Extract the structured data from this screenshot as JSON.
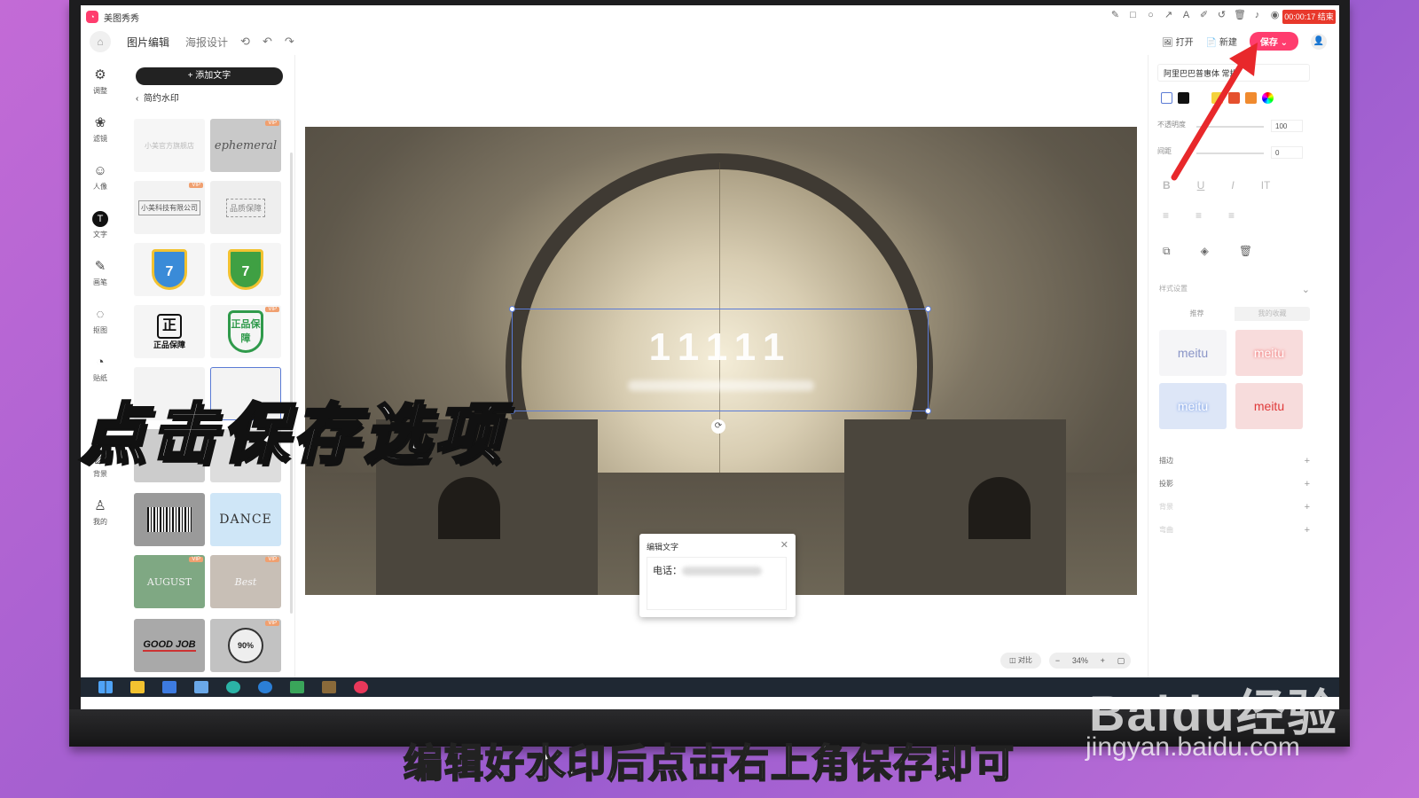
{
  "app": {
    "title": "美图秀秀",
    "record_time": "00:00:17 结束"
  },
  "menu": {
    "items": [
      "图片编辑",
      "海报设计"
    ],
    "open": "打开",
    "new": "新建",
    "save": "保存"
  },
  "rail": [
    {
      "label": "调整",
      "icon": "adjust-icon"
    },
    {
      "label": "滤镜",
      "icon": "filter-icon"
    },
    {
      "label": "人像",
      "icon": "portrait-icon"
    },
    {
      "label": "文字",
      "icon": "text-icon"
    },
    {
      "label": "画笔",
      "icon": "brush-icon"
    },
    {
      "label": "抠图",
      "icon": "cutout-icon"
    },
    {
      "label": "贴纸",
      "icon": "sticker-icon"
    },
    {
      "label": "背景",
      "icon": "background-icon"
    },
    {
      "label": "我的",
      "icon": "my-icon"
    }
  ],
  "panel": {
    "add_text": "+ 添加文字",
    "back_label": "简约水印",
    "thumbs": [
      "小美官方旗舰店",
      "ephemeral",
      "小美科技有限公司",
      "品质保障",
      "7",
      "7",
      "正品保障",
      "正品保障",
      "",
      "",
      "",
      "",
      "",
      "DANCE",
      "AUGUST",
      "Best",
      "GOOD JOB",
      "90% OFF"
    ]
  },
  "canvas": {
    "watermark_text": "11111"
  },
  "edit_dialog": {
    "title": "编辑文字",
    "content_label": "电话："
  },
  "right_panel": {
    "font": "阿里巴巴普惠体 常规",
    "opacity_label": "不透明度",
    "opacity_value": "100",
    "spacing_label": "间距",
    "spacing_value": "0",
    "style_section": "样式设置",
    "style_tabs": [
      "推荐",
      "我的收藏"
    ],
    "style_sample": "meitu",
    "items": [
      "描边",
      "投影",
      "背景",
      "弯曲"
    ]
  },
  "zoom": {
    "compare": "对比",
    "level": "34%"
  },
  "overlay": {
    "caption": "点击保存选项",
    "subtitle": "编辑好水印后点击右上角保存即可",
    "brand": "Baidu经验",
    "url": "jingyan.baidu.com"
  },
  "colors": {
    "accent": "#ff3d6e",
    "arrow": "#e8282b"
  }
}
